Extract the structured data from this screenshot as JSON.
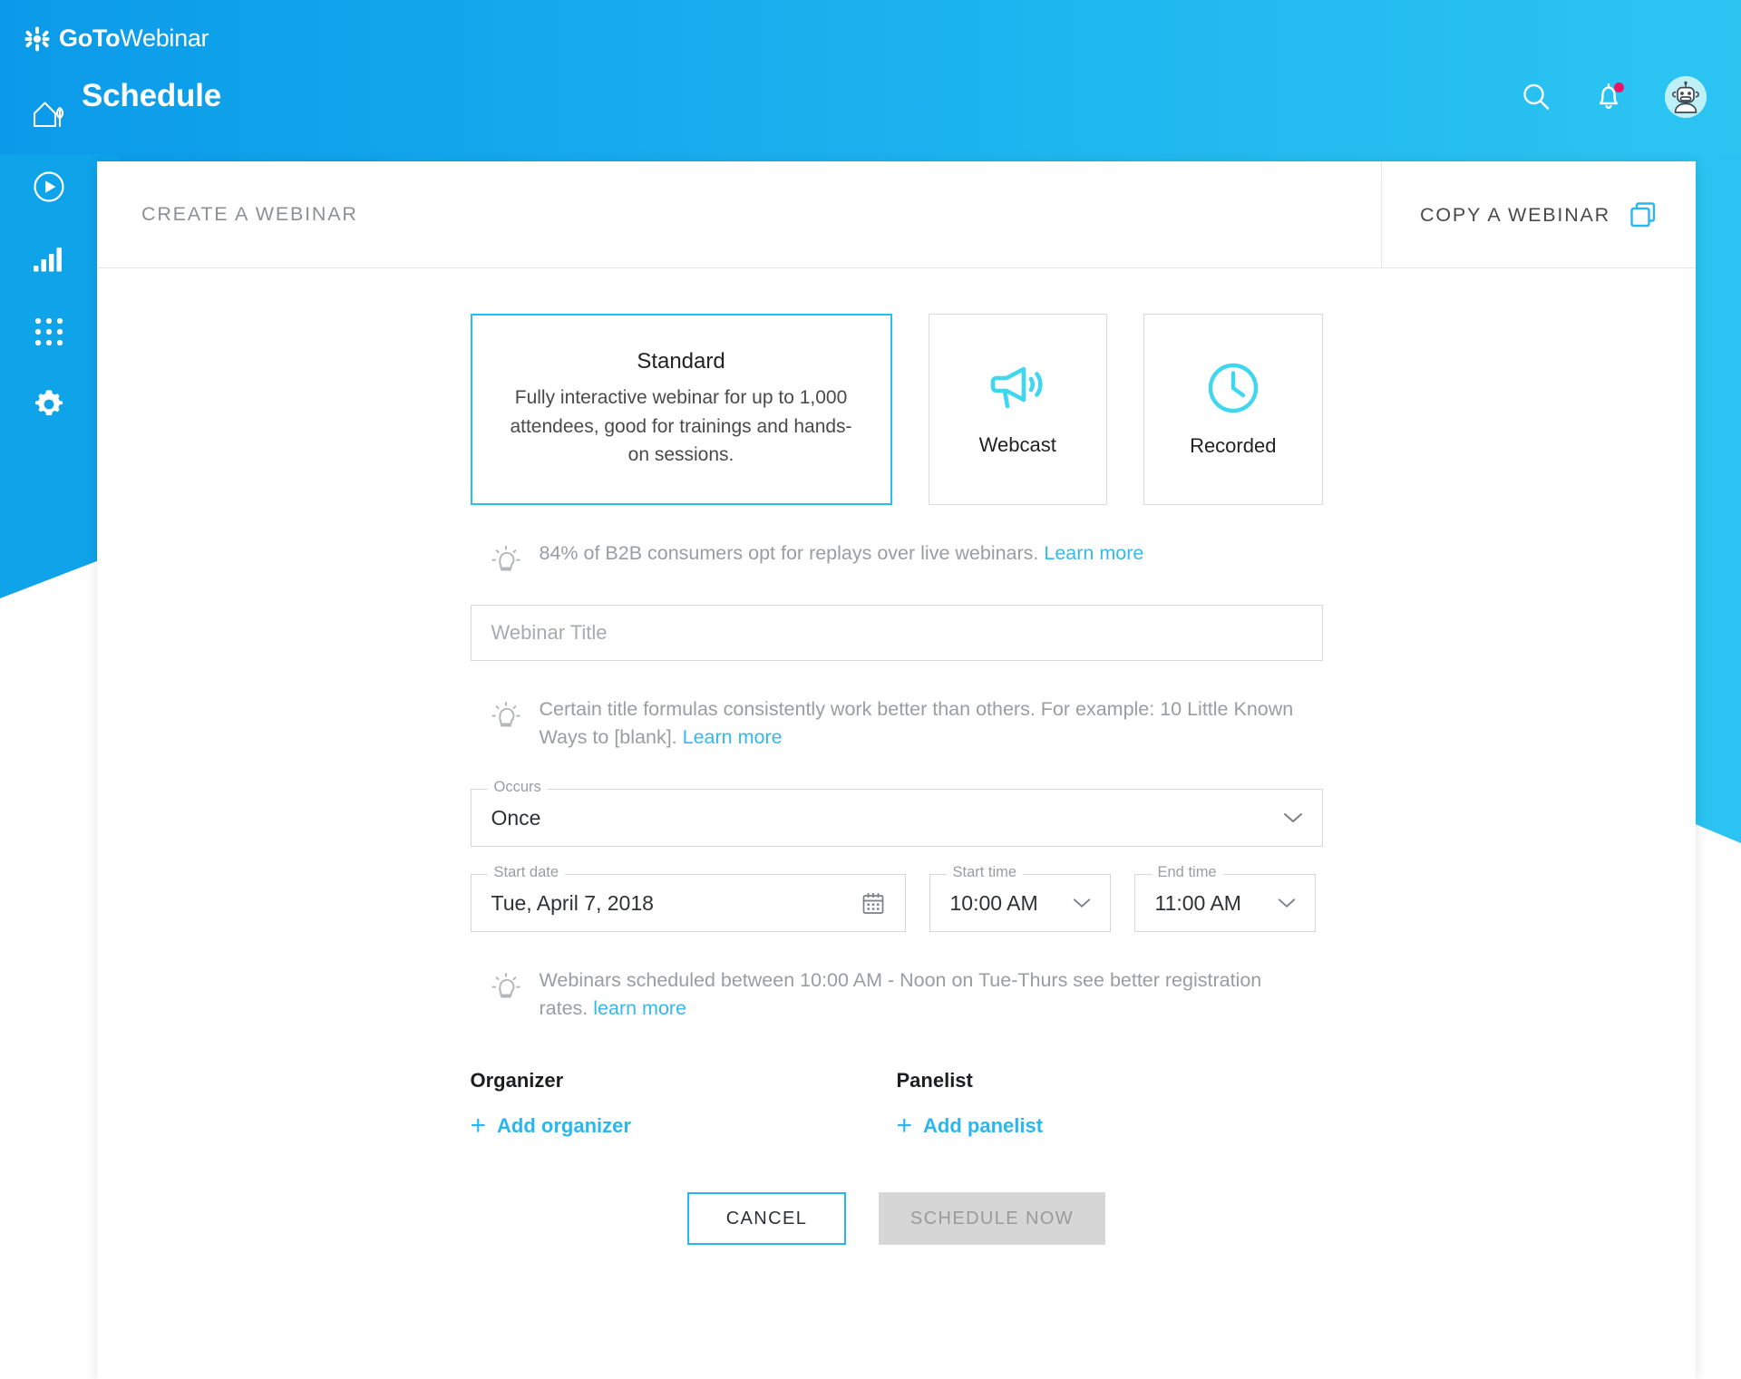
{
  "brand": {
    "logo_goto": "GoTo",
    "logo_webinar": "Webinar",
    "accent_cyan": "#25c0ef",
    "accent_blue": "#2ab6ef",
    "header_gradient_from": "#0b9ae9",
    "header_gradient_to": "#2cc5f2",
    "notification_dot": "#ea1566"
  },
  "header": {
    "page_title": "Schedule",
    "search_icon": "search-icon",
    "notifications_icon": "bell-icon",
    "avatar_icon": "robot-avatar"
  },
  "sidebar": {
    "items": [
      {
        "icon": "home-icon",
        "name": "home"
      },
      {
        "icon": "play-circle-icon",
        "name": "recordings"
      },
      {
        "icon": "bar-chart-icon",
        "name": "analytics"
      },
      {
        "icon": "grid-dots-icon",
        "name": "apps"
      },
      {
        "icon": "gear-icon",
        "name": "settings"
      }
    ]
  },
  "card": {
    "title": "CREATE A WEBINAR",
    "copy_webinar_label": "COPY A WEBINAR",
    "copy_webinar_icon": "copy-icon"
  },
  "webinar_types": [
    {
      "id": "standard",
      "label": "Standard",
      "description": "Fully interactive webinar for up to 1,000 attendees, good for trainings and hands-on sessions.",
      "selected": true,
      "icon": null
    },
    {
      "id": "webcast",
      "label": "Webcast",
      "description": "",
      "selected": false,
      "icon": "megaphone-icon"
    },
    {
      "id": "recorded",
      "label": "Recorded",
      "description": "",
      "selected": false,
      "icon": "clock-icon"
    }
  ],
  "tips": {
    "replays": {
      "icon": "lightbulb-icon",
      "text": "84% of B2B consumers opt for replays over live webinars.",
      "link": "Learn more"
    },
    "title_formula": {
      "icon": "lightbulb-icon",
      "text": "Certain title formulas consistently work better than others. For example: 10 Little Known Ways to [blank].",
      "link": "Learn more"
    },
    "timing": {
      "icon": "lightbulb-icon",
      "text": "Webinars scheduled between 10:00 AM - Noon on Tue-Thurs see better registration rates.",
      "link": "learn more"
    }
  },
  "form": {
    "webinar_title": {
      "placeholder": "Webinar Title",
      "value": ""
    },
    "occurs": {
      "label": "Occurs",
      "value": "Once",
      "icon": "chevron-down-icon"
    },
    "start_date": {
      "label": "Start date",
      "value": "Tue, April 7, 2018",
      "icon": "calendar-icon"
    },
    "start_time": {
      "label": "Start time",
      "value": "10:00 AM",
      "icon": "chevron-down-icon"
    },
    "end_time": {
      "label": "End time",
      "value": "11:00 AM",
      "icon": "chevron-down-icon"
    }
  },
  "people": {
    "organizer": {
      "heading": "Organizer",
      "add_label": "Add organizer",
      "plus": "+"
    },
    "panelist": {
      "heading": "Panelist",
      "add_label": "Add panelist",
      "plus": "+"
    }
  },
  "actions": {
    "cancel": "CANCEL",
    "schedule": "SCHEDULE NOW",
    "schedule_disabled": true
  }
}
